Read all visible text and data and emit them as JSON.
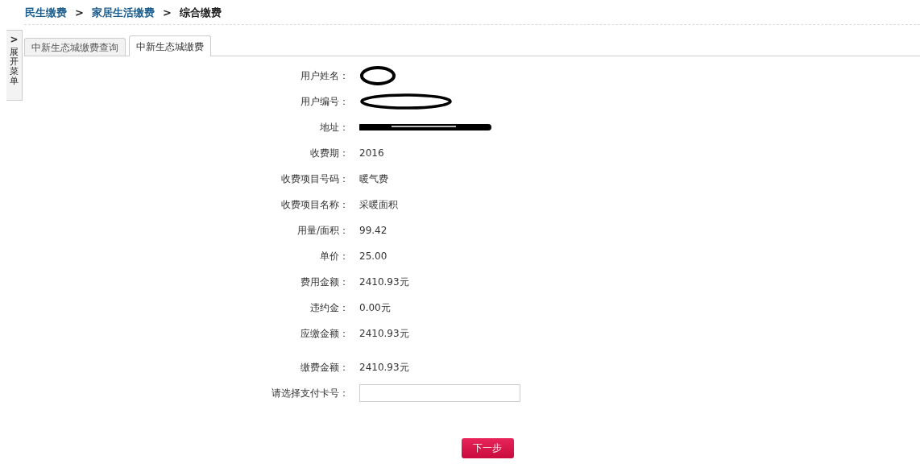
{
  "breadcrumb": [
    {
      "label": "民生缴费",
      "current": false
    },
    {
      "label": "家居生活缴费",
      "current": false
    },
    {
      "label": "综合缴费",
      "current": true
    }
  ],
  "breadcrumb_separator": ">",
  "sidebar_toggle": {
    "arrow": ">",
    "label": "展开菜单"
  },
  "tabs": [
    {
      "label": "中新生态城缴费查询",
      "selected": false
    },
    {
      "label": "中新生态城缴费",
      "selected": true
    }
  ],
  "fields": [
    {
      "label": "用户姓名：",
      "kind": "redacted-name"
    },
    {
      "label": "用户编号：",
      "kind": "redacted-number"
    },
    {
      "label": "地址：",
      "kind": "redacted-address"
    },
    {
      "label": "收费期：",
      "kind": "text",
      "value": "2016"
    },
    {
      "label": "收费项目号码：",
      "kind": "text",
      "value": "暖气费"
    },
    {
      "label": "收费项目名称：",
      "kind": "text",
      "value": "采暖面积"
    },
    {
      "label": "用量/面积：",
      "kind": "text",
      "value": "99.42"
    },
    {
      "label": "单价：",
      "kind": "text",
      "value": "25.00"
    },
    {
      "label": "费用金额：",
      "kind": "text",
      "value": "2410.93元"
    },
    {
      "label": "违约金：",
      "kind": "text",
      "value": "0.00元"
    },
    {
      "label": "应缴金额：",
      "kind": "text",
      "value": "2410.93元"
    },
    {
      "label": "缴费金额：",
      "kind": "total",
      "value": "2410.93元"
    },
    {
      "label": "请选择支付卡号：",
      "kind": "input"
    }
  ],
  "next_button": "下一步"
}
